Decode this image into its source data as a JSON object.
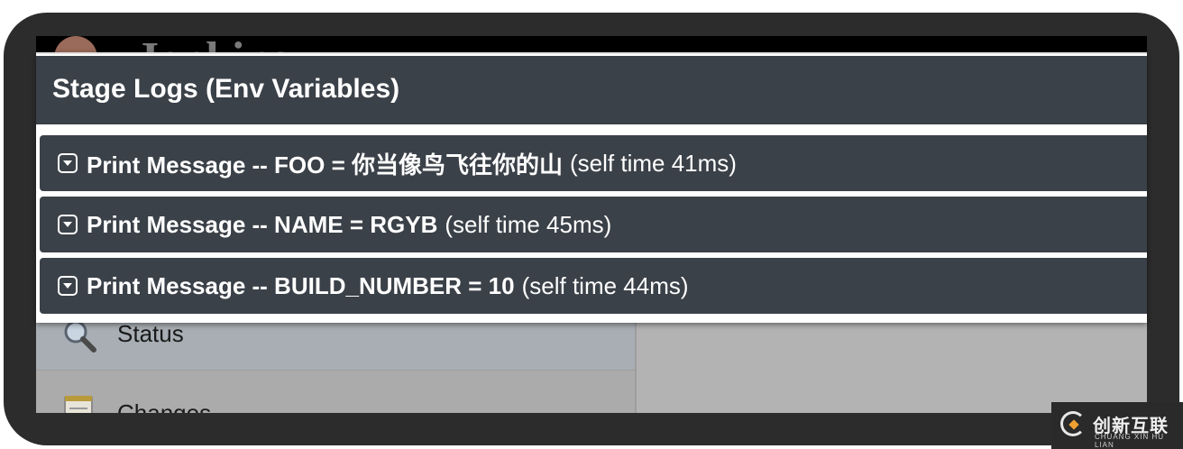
{
  "background": {
    "logo_text": "Jenkins",
    "sidebar": [
      {
        "label": "Status",
        "icon": "magnifier-icon"
      },
      {
        "label": "Changes",
        "icon": "notepad-icon"
      }
    ]
  },
  "modal": {
    "title": "Stage Logs (Env Variables)",
    "rows": [
      {
        "name": "Print Message -- FOO = 你当像鸟飞往你的山",
        "time": "(self time 41ms)"
      },
      {
        "name": "Print Message -- NAME = RGYB",
        "time": "(self time 45ms)"
      },
      {
        "name": "Print Message -- BUILD_NUMBER = 10",
        "time": "(self time 44ms)"
      }
    ]
  },
  "watermark": {
    "cn": "创新互联",
    "en": "CHUANG XIN HU LIAN"
  },
  "colors": {
    "panel": "#3b4148",
    "frame": "#2c2c2c",
    "accent": "#f0a030"
  }
}
